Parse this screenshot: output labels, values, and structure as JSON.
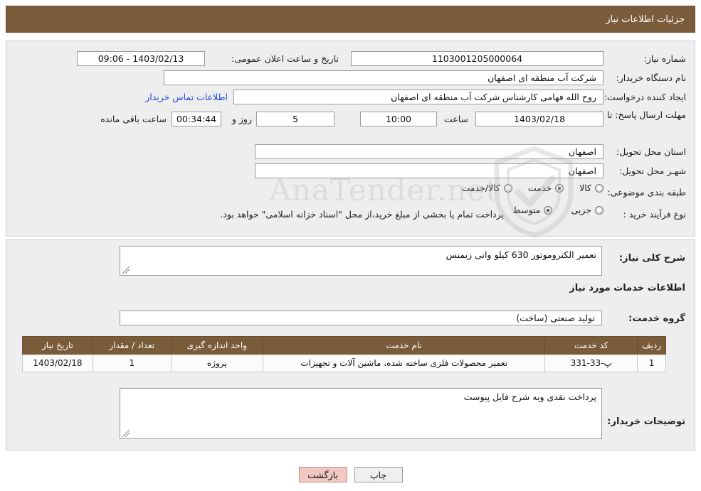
{
  "header": {
    "title": "جزئیات اطلاعات نیاز"
  },
  "watermark": {
    "text": "AnaTender.net",
    "shield_icon": "shield-icon"
  },
  "top_form": {
    "need_number": {
      "label": "شماره نیاز:",
      "value": "1103001205000064"
    },
    "public_announce": {
      "label": "تاریخ و ساعت اعلان عمومی:",
      "value": "1403/02/13 - 09:06"
    },
    "buyer_org": {
      "label": "نام دستگاه خریدار:",
      "value": "شرکت آب منطقه ای اصفهان"
    },
    "requester": {
      "label": "ایجاد کننده درخواست:",
      "value": "روح الله فهامی کارشناس شرکت آب منطقه ای اصفهان",
      "link": "اطلاعات تماس خریدار"
    },
    "deadline": {
      "label": "مهلت ارسال پاسخ: تا تاریخ:",
      "date": "1403/02/18",
      "hour_label": "ساعت",
      "hour": "10:00",
      "days": "5",
      "days_label": "روز و",
      "remaining": "00:34:44",
      "remaining_label": "ساعت باقی مانده"
    },
    "province": {
      "label": "استان محل تحویل:",
      "value": "اصفهان"
    },
    "city": {
      "label": "شهـر محل تحویل:",
      "value": "اصفهان"
    },
    "category": {
      "label": "طبقه بندی موضوعی:",
      "options": [
        {
          "text": "کالا",
          "checked": false
        },
        {
          "text": "خدمت",
          "checked": true
        },
        {
          "text": "کالا/خدمت",
          "checked": false
        }
      ]
    },
    "purchase_type": {
      "label": "نوع فرآیند خرید :",
      "options": [
        {
          "text": "جزیی",
          "checked": false
        },
        {
          "text": "متوسط",
          "checked": true
        }
      ],
      "note": "پرداخت تمام یا بخشی از مبلغ خرید،از محل \"اسناد خزانه اسلامی\" خواهد بود."
    }
  },
  "mid": {
    "general_desc_label": "شرح کلی نیاز:",
    "general_desc_value": "تعمیر الکتروموتور 630 کیلو واتی زیمنس",
    "services_info_title": "اطلاعات خدمات مورد نیاز",
    "service_group_label": "گروه خدمت:",
    "service_group_value": "تولید صنعتی (ساخت)",
    "table": {
      "headers": [
        "ردیف",
        "کد خدمت",
        "نام خدمت",
        "واحد اندازه گیری",
        "تعداد / مقدار",
        "تاریخ نیاز"
      ],
      "rows": [
        [
          "1",
          "پ-33-331",
          "تعمیر محصولات فلزی ساخته شده، ماشین آلات و تجهیزات",
          "پروژه",
          "1",
          "1403/02/18"
        ]
      ]
    },
    "buyer_notes_label": "توضیحات خریدار:",
    "buyer_notes_value": "پرداخت نقدی وبه شرح فایل پیوست"
  },
  "footer": {
    "print_label": "چاپ",
    "back_label": "بازگشت"
  },
  "colors": {
    "header_bg": "#7b5c3a",
    "panel_bg": "#eeeeee",
    "link": "#1a4bd6",
    "back_btn": "#f2c9c2"
  }
}
